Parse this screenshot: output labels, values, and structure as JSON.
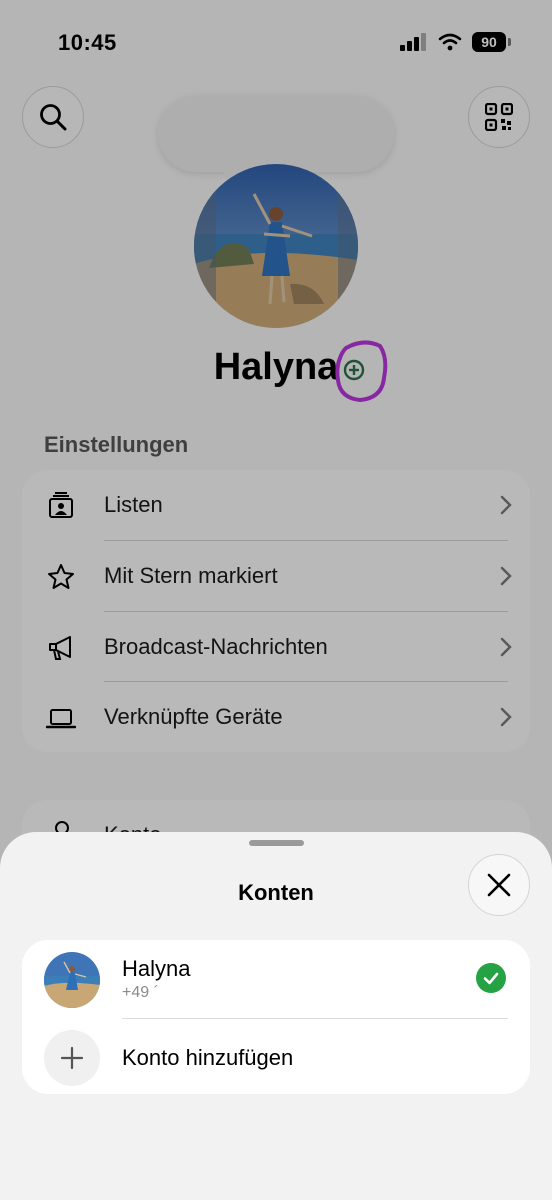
{
  "status_bar": {
    "time": "10:45",
    "battery": "90"
  },
  "profile": {
    "name": "Halyna"
  },
  "settings": {
    "section_title": "Einstellungen",
    "items": [
      {
        "label": "Listen",
        "icon": "lists-icon"
      },
      {
        "label": "Mit Stern markiert",
        "icon": "star-icon"
      },
      {
        "label": "Broadcast-Nachrichten",
        "icon": "megaphone-icon"
      },
      {
        "label": "Verknüpfte Geräte",
        "icon": "laptop-icon"
      }
    ],
    "next_item": {
      "label": "Konto",
      "icon": "key-icon"
    }
  },
  "sheet": {
    "title": "Konten",
    "accounts": [
      {
        "name": "Halyna",
        "phone": "+49 ´",
        "selected": true
      }
    ],
    "add_account_label": "Konto hinzufügen"
  },
  "colors": {
    "accent_green": "#25a244",
    "highlight": "#b535d9"
  }
}
